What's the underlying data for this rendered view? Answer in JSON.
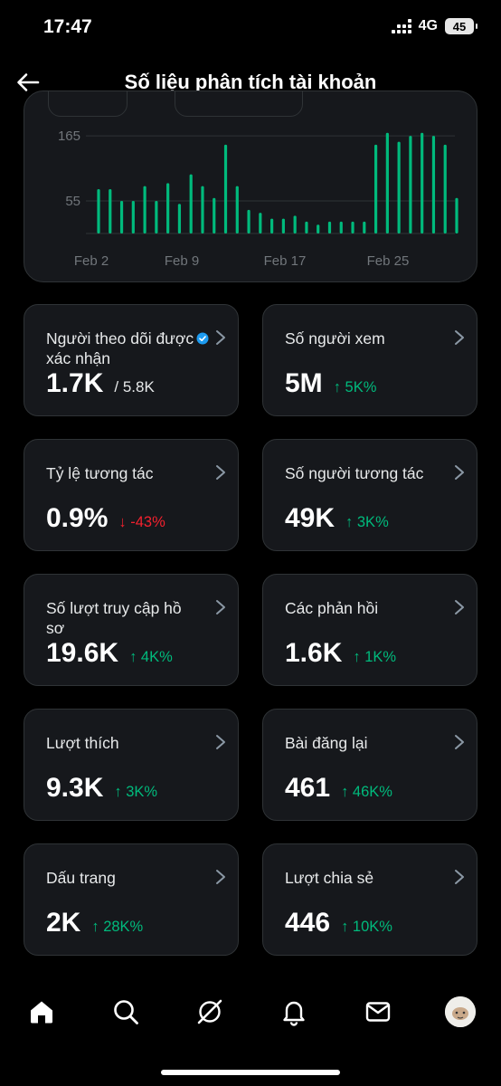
{
  "status_bar": {
    "time": "17:47",
    "network": "4G",
    "battery": "45"
  },
  "header": {
    "title": "Số liệu phân tích tài khoản"
  },
  "colors": {
    "accent": "#1d9bf0",
    "positive": "#00ba7c",
    "negative": "#f4212e",
    "bar": "#00ba7c"
  },
  "chart_data": {
    "type": "bar",
    "y_ticks": [
      "165",
      "55"
    ],
    "x_ticks": [
      "Feb 2",
      "Feb 9",
      "Feb 17",
      "Feb 25"
    ],
    "ylim": [
      0,
      185
    ],
    "series": [
      {
        "values": [
          75,
          75,
          55,
          55,
          80,
          55,
          85,
          50,
          100,
          80,
          60,
          150,
          80,
          40,
          35,
          25,
          25,
          30,
          20,
          15,
          20,
          20,
          20,
          20,
          150,
          170,
          155,
          165,
          170,
          165,
          150,
          60
        ]
      }
    ]
  },
  "metrics": [
    {
      "label": "Người theo dõi được xác nhận",
      "value": "1.7K",
      "secondary": "/ 5.8K",
      "verified": true
    },
    {
      "label": "Số người xem",
      "value": "5M",
      "change": "↑ 5K%",
      "direction": "up"
    },
    {
      "label": "Tỷ lệ tương tác",
      "value": "0.9%",
      "change": "↓ -43%",
      "direction": "down"
    },
    {
      "label": "Số người tương tác",
      "value": "49K",
      "change": "↑ 3K%",
      "direction": "up"
    },
    {
      "label": "Số lượt truy cập hồ sơ",
      "value": "19.6K",
      "change": "↑ 4K%",
      "direction": "up"
    },
    {
      "label": "Các phản hồi",
      "value": "1.6K",
      "change": "↑ 1K%",
      "direction": "up"
    },
    {
      "label": "Lượt thích",
      "value": "9.3K",
      "change": "↑ 3K%",
      "direction": "up"
    },
    {
      "label": "Bài đăng lại",
      "value": "461",
      "change": "↑ 46K%",
      "direction": "up"
    },
    {
      "label": "Dấu trang",
      "value": "2K",
      "change": "↑ 28K%",
      "direction": "up"
    },
    {
      "label": "Lượt chia sẻ",
      "value": "446",
      "change": "↑ 10K%",
      "direction": "up"
    }
  ],
  "bottom_nav": [
    "home-icon",
    "search-icon",
    "grok-icon",
    "notifications-icon",
    "messages-icon",
    "profile-avatar"
  ]
}
